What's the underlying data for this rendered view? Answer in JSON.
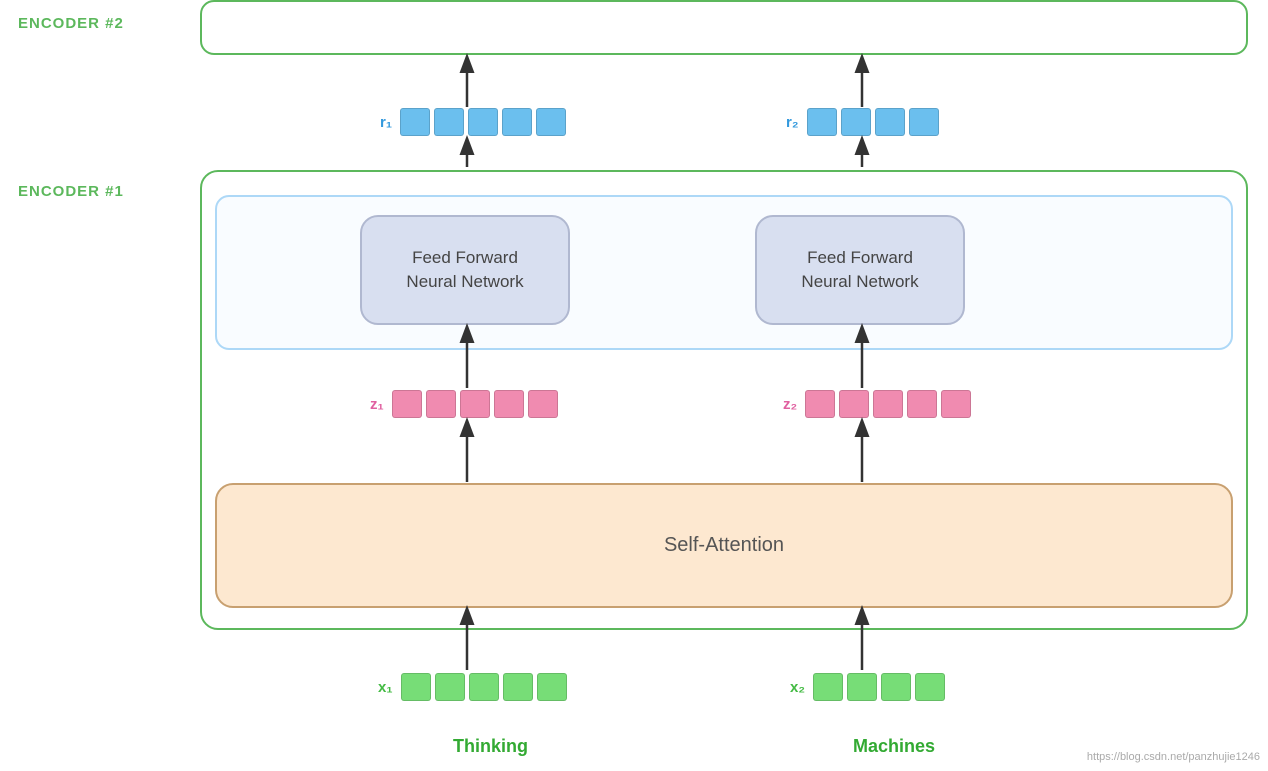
{
  "encoder2": {
    "label": "ENCODER #2"
  },
  "encoder1": {
    "label": "ENCODER #1"
  },
  "ffnn": {
    "label": "Feed Forward\nNeural Network"
  },
  "self_attention": {
    "label": "Self-Attention"
  },
  "vectors": {
    "r1_label": "r₁",
    "r2_label": "r₂",
    "z1_label": "z₁",
    "z2_label": "z₂",
    "x1_label": "x₁",
    "x2_label": "x₂"
  },
  "words": {
    "word1": "Thinking",
    "word2": "Machines"
  },
  "watermark": "https://blog.csdn.net/panzhujie1246"
}
